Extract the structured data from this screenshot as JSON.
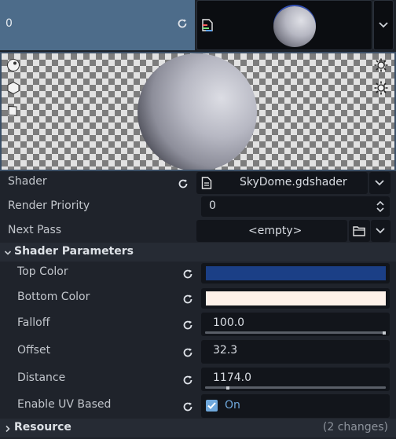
{
  "header": {
    "index_label": "0"
  },
  "properties": {
    "shader": {
      "label": "Shader",
      "value": "SkyDome.gdshader"
    },
    "render_priority": {
      "label": "Render Priority",
      "value": "0"
    },
    "next_pass": {
      "label": "Next Pass",
      "value": "<empty>"
    }
  },
  "shader_parameters": {
    "title": "Shader Parameters",
    "top_color": {
      "label": "Top Color",
      "color": "#1b3f86"
    },
    "bottom_color": {
      "label": "Bottom Color",
      "color": "#fdf1e9"
    },
    "falloff": {
      "label": "Falloff",
      "value": "100.0",
      "fraction": 1.0
    },
    "offset": {
      "label": "Offset",
      "value": "32.3"
    },
    "distance": {
      "label": "Distance",
      "value": "1174.0",
      "fraction": 0.12
    },
    "enable_uv_based": {
      "label": "Enable UV Based",
      "value": "On",
      "checked": true
    }
  },
  "resource": {
    "title": "Resource",
    "changes": "(2 changes)"
  },
  "colors": {
    "selection": "#4d6c8a",
    "accent": "#6fa8dc",
    "panel": "#1f232b"
  },
  "icons": [
    "revert-icon",
    "shader-material-icon",
    "chevron-down-icon",
    "sphere-preview-icon",
    "box-preview-icon",
    "quad-preview-icon",
    "light-toggle-icon",
    "file-icon",
    "stepper-icon",
    "folder-icon",
    "chevron-right-icon",
    "checkbox-icon"
  ]
}
